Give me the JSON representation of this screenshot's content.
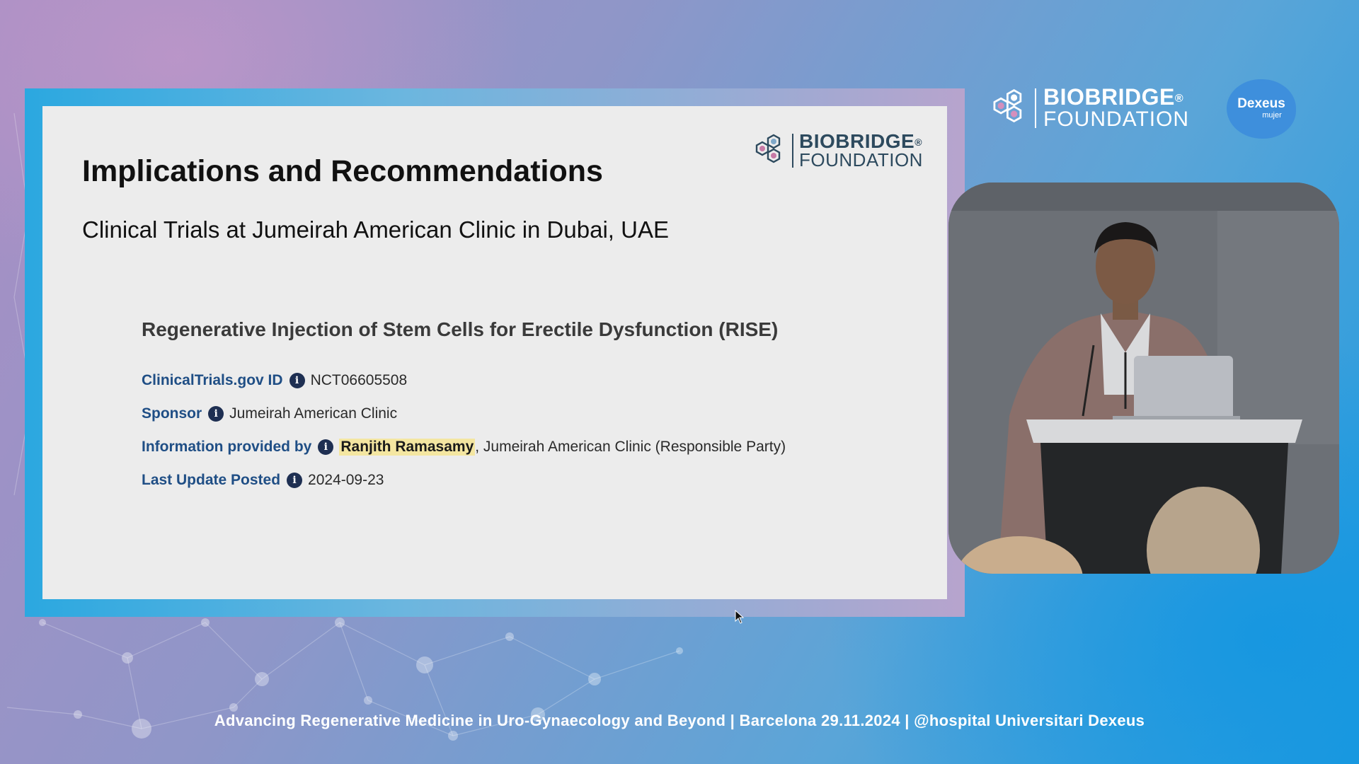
{
  "slide": {
    "title": "Implications and Recommendations",
    "subtitle": "Clinical Trials at Jumeirah American Clinic in Dubai, UAE",
    "logo": {
      "line1": "BIOBRIDGE",
      "registered": "®",
      "line2": "FOUNDATION"
    }
  },
  "trial": {
    "title": "Regenerative Injection of Stem Cells for Erectile Dysfunction (RISE)",
    "info_icon": "i",
    "fields": [
      {
        "label": "ClinicalTrials.gov ID",
        "value": "NCT06605508"
      },
      {
        "label": "Sponsor",
        "value": "Jumeirah American Clinic"
      },
      {
        "label": "Information provided by",
        "highlight": "Ranjith Ramasamy",
        "value": ", Jumeirah American Clinic (Responsible Party)"
      },
      {
        "label": "Last Update Posted",
        "value": "2024-09-23"
      }
    ]
  },
  "overlay": {
    "brand": {
      "line1": "BIOBRIDGE",
      "registered": "®",
      "line2": "FOUNDATION"
    },
    "partner": {
      "name": "Dexeus",
      "sub": "mujer"
    }
  },
  "footer": {
    "text": "Advancing Regenerative Medicine in Uro-Gynaecology and Beyond | Barcelona 29.11.2024 | @hospital Universitari Dexeus"
  },
  "icons": {
    "logo": "hexagon-molecule-icon",
    "info": "info-circle-icon",
    "cursor": "mouse-pointer-icon"
  },
  "colors": {
    "label_blue": "#1f4e85",
    "highlight": "#f4e6a1",
    "slide_bg": "#ececec",
    "logo_dark": "#2d4a5e"
  }
}
